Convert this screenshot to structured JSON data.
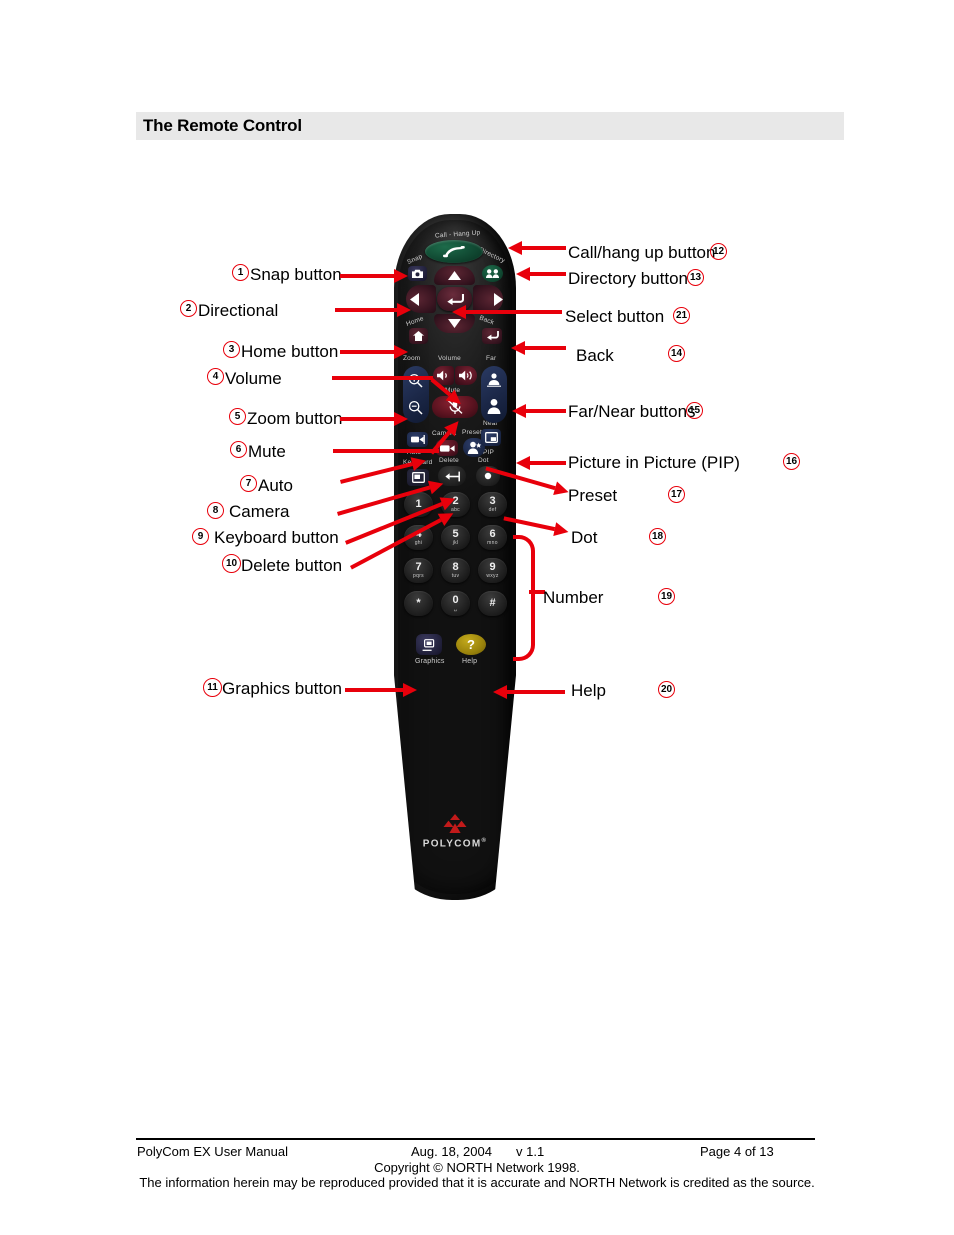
{
  "header": {
    "title": "The Remote Control"
  },
  "callouts_left": [
    {
      "n": "1",
      "label": "Snap button"
    },
    {
      "n": "2",
      "label": "Directional"
    },
    {
      "n": "3",
      "label": "Home button"
    },
    {
      "n": "4",
      "label": "Volume"
    },
    {
      "n": "5",
      "label": "Zoom button"
    },
    {
      "n": "6",
      "label": "Mute"
    },
    {
      "n": "7",
      "label": "Auto"
    },
    {
      "n": "8",
      "label": "Camera"
    },
    {
      "n": "9",
      "label": "Keyboard button"
    },
    {
      "n": "10",
      "label": "Delete button"
    },
    {
      "n": "11",
      "label": "Graphics button"
    }
  ],
  "callouts_right": [
    {
      "n": "12",
      "label": "Call/hang up button"
    },
    {
      "n": "13",
      "label": "Directory button"
    },
    {
      "n": "21",
      "label": "Select button"
    },
    {
      "n": "14",
      "label": "Back"
    },
    {
      "n": "15",
      "label": "Far/Near buttons"
    },
    {
      "n": "16",
      "label": "Picture in Picture (PIP)"
    },
    {
      "n": "17",
      "label": "Preset"
    },
    {
      "n": "18",
      "label": "Dot"
    },
    {
      "n": "19",
      "label": "Number"
    },
    {
      "n": "20",
      "label": "Help"
    }
  ],
  "remote": {
    "brand": "POLYCOM",
    "brand_suffix": "®",
    "help_glyph": "?",
    "captions": {
      "call": "Call - Hang Up",
      "snap": "Snap",
      "directory": "Directory",
      "home": "Home",
      "back": "Back",
      "zoom": "Zoom",
      "volume": "Volume",
      "far": "Far",
      "mute": "Mute",
      "near": "Near",
      "auto": "Auto",
      "camera": "Camera",
      "preset": "Preset",
      "pip": "PIP",
      "keyboard": "Keyboard",
      "delete": "Delete",
      "dot": "Dot",
      "graphics": "Graphics",
      "help": "Help"
    },
    "keypad": [
      {
        "d": "1",
        "s": ""
      },
      {
        "d": "2",
        "s": "abc"
      },
      {
        "d": "3",
        "s": "def"
      },
      {
        "d": "4",
        "s": "ghi"
      },
      {
        "d": "5",
        "s": "jkl"
      },
      {
        "d": "6",
        "s": "mno"
      },
      {
        "d": "7",
        "s": "pqrs"
      },
      {
        "d": "8",
        "s": "tuv"
      },
      {
        "d": "9",
        "s": "wxyz"
      },
      {
        "d": "*",
        "s": ""
      },
      {
        "d": "0",
        "s": "␣"
      },
      {
        "d": "#",
        "s": ""
      }
    ]
  },
  "footer": {
    "manual": "PolyCom EX User Manual",
    "date": "Aug. 18, 2004",
    "version": "v 1.1",
    "page": "Page 4 of 13",
    "copyright": "Copyright © NORTH Network 1998.",
    "notice": "The information herein may be reproduced provided that it is accurate and NORTH Network is credited as the source."
  },
  "colors": {
    "accent_red": "#e8000b",
    "header_bg": "#e8e8e8"
  }
}
